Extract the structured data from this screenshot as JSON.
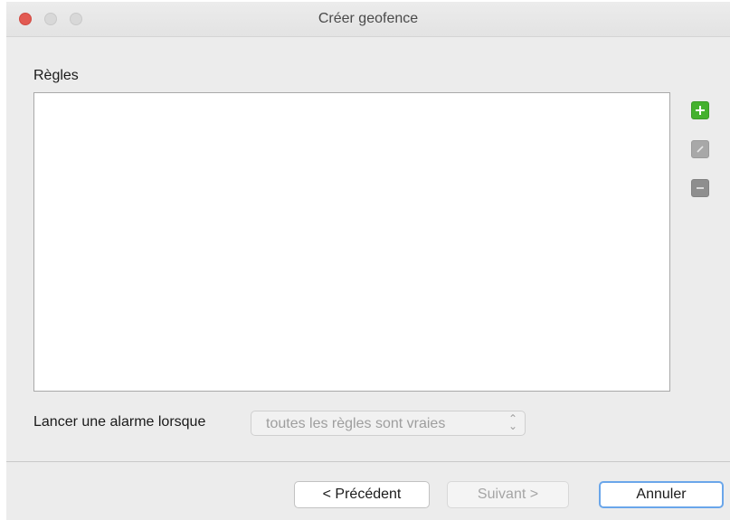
{
  "window": {
    "title": "Créer geofence"
  },
  "rules": {
    "label": "Règles",
    "items": []
  },
  "side_buttons": {
    "add_icon": "plus-icon",
    "edit_icon": "edit-icon",
    "remove_icon": "minus-icon"
  },
  "alarm": {
    "label": "Lancer une alarme lorsque",
    "selected_value": "toutes les règles sont vraies"
  },
  "footer": {
    "prev_label": "< Précédent",
    "next_label": "Suivant >",
    "cancel_label": "Annuler"
  },
  "colors": {
    "add_green": "#44b12e",
    "close_red": "#e25a52",
    "focus_blue": "#6aa6ea"
  }
}
